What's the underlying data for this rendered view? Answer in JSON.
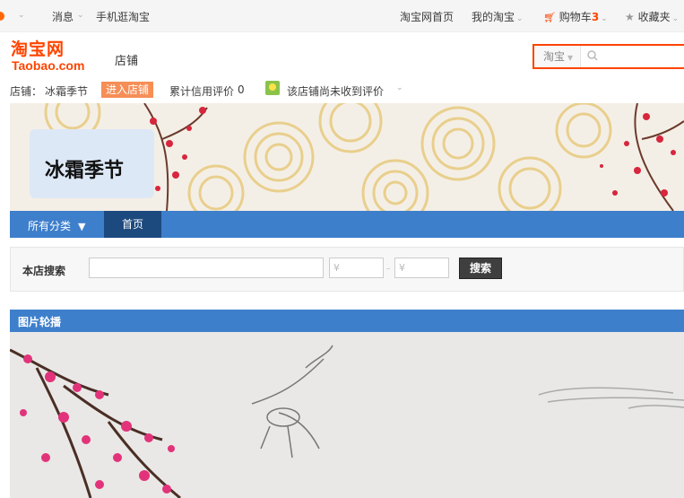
{
  "topbar": {
    "messages": "消息",
    "mobile": "手机逛淘宝",
    "taobao_home": "淘宝网首页",
    "my_taobao": "我的淘宝",
    "cart": "购物车",
    "cart_count": "3",
    "favorites": "收藏夹"
  },
  "header": {
    "logo_cn": "淘宝网",
    "logo_en": "Taobao.com",
    "shop_label": "店铺",
    "search_scope": "淘宝",
    "search_value": ""
  },
  "shop_info": {
    "shop_prefix": "店铺：",
    "shop_name": "冰霜季节",
    "enter_shop": "进入店铺",
    "credit_label": "累计信用评价",
    "credit_value": "0",
    "no_rating": "该店铺尚未收到评价"
  },
  "banner": {
    "shop_name": "冰霜季节"
  },
  "nav": {
    "all_categories": "所有分类",
    "home": "首页"
  },
  "shop_search": {
    "label": "本店搜索",
    "keyword_value": "",
    "price_min_placeholder": "¥",
    "price_max_placeholder": "¥",
    "dash": "-",
    "button": "搜索"
  },
  "carousel": {
    "title": "图片轮播"
  },
  "colors": {
    "brand_orange": "#ff4400",
    "nav_blue": "#3e7fcc",
    "nav_active": "#1d4a7e",
    "enter_shop_bg": "#f68e56"
  }
}
